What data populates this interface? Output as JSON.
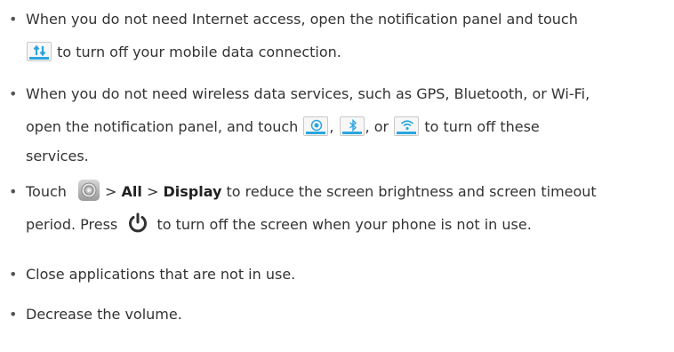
{
  "bullet": "•",
  "item1": {
    "line1": "When you do not need Internet access, open the notification panel and touch",
    "line2": "to turn off your mobile data connection."
  },
  "item2": {
    "line1": "When you do not need wireless data services, such as GPS, Bluetooth, or Wi-Fi,",
    "line2_a": "open the notification panel, and touch",
    "comma1": ",",
    "comma2": ", or",
    "line2_b": "to turn off these",
    "line3": "services."
  },
  "item3": {
    "touch": "Touch",
    "sep1": ">",
    "all": "All",
    "sep2": ">",
    "display": "Display",
    "rest": "to reduce the screen brightness and screen timeout",
    "line2_a": "period. Press",
    "line2_b": "to turn off the screen when your phone is not in use."
  },
  "item4": "Close applications that are not in use.",
  "item5": "Decrease the volume.",
  "icons": {
    "data": "mobile-data-icon",
    "gps": "gps-icon",
    "bluetooth": "bluetooth-icon",
    "wifi": "wifi-icon",
    "settings": "settings-icon",
    "power": "power-icon"
  },
  "accent_color": "#2aa6e0"
}
